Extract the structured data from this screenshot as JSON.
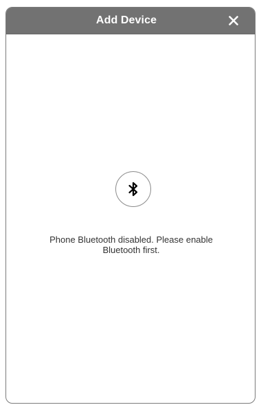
{
  "dialog": {
    "title": "Add Device",
    "close_icon": "close-icon",
    "bluetooth_icon": "bluetooth-icon",
    "message": "Phone Bluetooth disabled. Please enable Bluetooth first."
  },
  "colors": {
    "header_bg": "#727272",
    "header_text": "#ffffff",
    "border": "#7a7a7a",
    "message_text": "#333333",
    "icon_stroke": "#000000"
  }
}
